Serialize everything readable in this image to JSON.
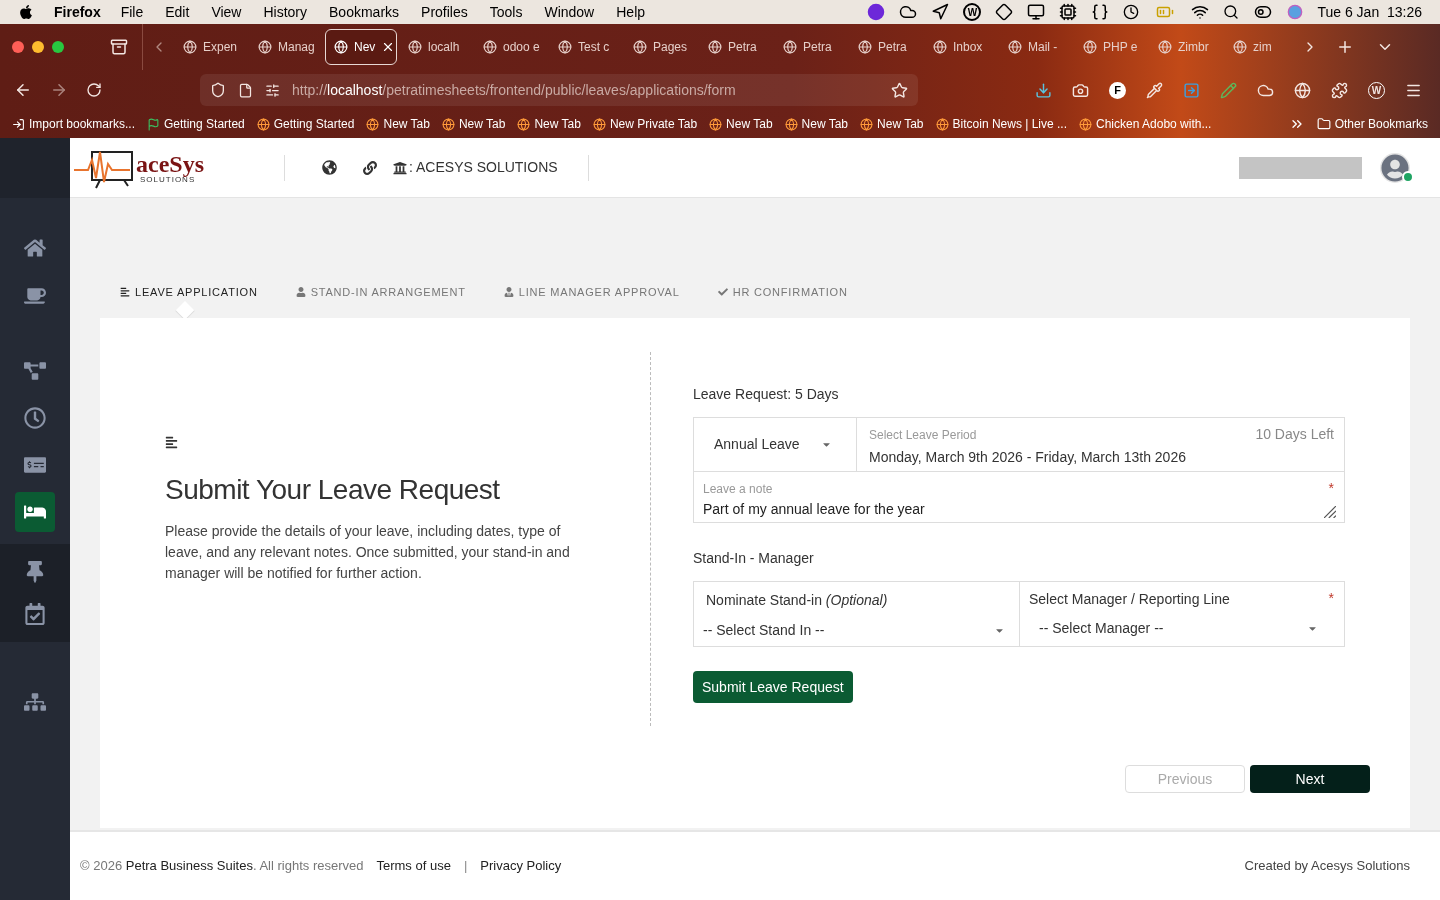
{
  "menu_bar": {
    "app": "Firefox",
    "menus": [
      "File",
      "Edit",
      "View",
      "History",
      "Bookmarks",
      "Profiles",
      "Tools",
      "Window",
      "Help"
    ],
    "status_letter": "W",
    "clock": "Tue 6 Jan  13:26"
  },
  "browser": {
    "tabs": [
      {
        "label": "Expen",
        "selected": false
      },
      {
        "label": "Manag",
        "selected": false
      },
      {
        "label": "Nev",
        "selected": true
      },
      {
        "label": "localh",
        "selected": false
      },
      {
        "label": "odoo e",
        "selected": false
      },
      {
        "label": "Test c",
        "selected": false
      },
      {
        "label": "Pages",
        "selected": false
      },
      {
        "label": "Petra",
        "selected": false
      },
      {
        "label": "Petra",
        "selected": false
      },
      {
        "label": "Petra",
        "selected": false
      },
      {
        "label": "Inbox",
        "selected": false
      },
      {
        "label": "Mail -",
        "selected": false
      },
      {
        "label": "PHP e",
        "selected": false
      },
      {
        "label": "Zimbr",
        "selected": false
      },
      {
        "label": "zim",
        "selected": false
      }
    ],
    "url": "http://**localhost**/petratimesheets/frontend/public/leaves/applications/form",
    "extension_letters": [
      "F",
      "W"
    ],
    "bookmarks": [
      "Import bookmarks...",
      "Getting Started",
      "Getting Started",
      "New Tab",
      "New Tab",
      "New Tab",
      "New Private Tab",
      "New Tab",
      "New Tab",
      "New Tab",
      "Bitcoin News | Live ...",
      "Chicken Adobo with..."
    ],
    "other_bookmarks": "Other Bookmarks"
  },
  "app": {
    "logo": {
      "name": "aceSys",
      "tagline": "SOLUTIONS"
    },
    "company": ": ACESYS SOLUTIONS",
    "sidebar": [
      {
        "selected": false
      },
      {
        "selected": false
      },
      {
        "selected": false
      },
      {
        "selected": false
      },
      {
        "selected": false
      },
      {
        "selected": true
      },
      {
        "selected": false
      },
      {
        "selected": false
      },
      {
        "selected": false
      }
    ],
    "steps": [
      {
        "label": "LEAVE APPLICATION",
        "selected": true
      },
      {
        "label": "STAND-IN ARRANGEMENT",
        "selected": false
      },
      {
        "label": "LINE MANAGER APPROVAL",
        "selected": false
      },
      {
        "label": "HR CONFIRMATION",
        "selected": false
      }
    ],
    "intro": {
      "title": "Submit Your Leave Request",
      "text": "Please provide the details of your leave, including dates, type of leave, and any relevant notes. Once submitted, your stand-in and manager will be notified for further action."
    },
    "form": {
      "request_heading": "Leave Request: 5 Days",
      "leave_type": "Annual Leave",
      "period": {
        "label": "Select Leave Period",
        "value": "Monday, March 9th 2026 - Friday, March 13th 2026",
        "remaining": "10 Days Left"
      },
      "note": {
        "label": "Leave a note",
        "value": "Part of my annual leave for the year",
        "required_mark": "*"
      },
      "standin_heading": "Stand-In - Manager",
      "standin": {
        "label": "Nominate Stand-in *(Optional)*",
        "value": "-- Select Stand In --"
      },
      "manager": {
        "label": "Select Manager / Reporting Line",
        "value": "-- Select Manager --",
        "required_mark": "*"
      },
      "submit": "Submit Leave Request"
    },
    "pager": {
      "previous": {
        "label": "Previous",
        "disabled": true
      },
      "next": {
        "label": "Next",
        "disabled": false
      }
    },
    "footer": {
      "copyright": "© 2026 **Petra Business Suites**. All rights reserved",
      "links": [
        "Terms of use",
        "Privacy Policy"
      ],
      "separator": "|",
      "credit": "Created by Acesys Solutions"
    }
  }
}
